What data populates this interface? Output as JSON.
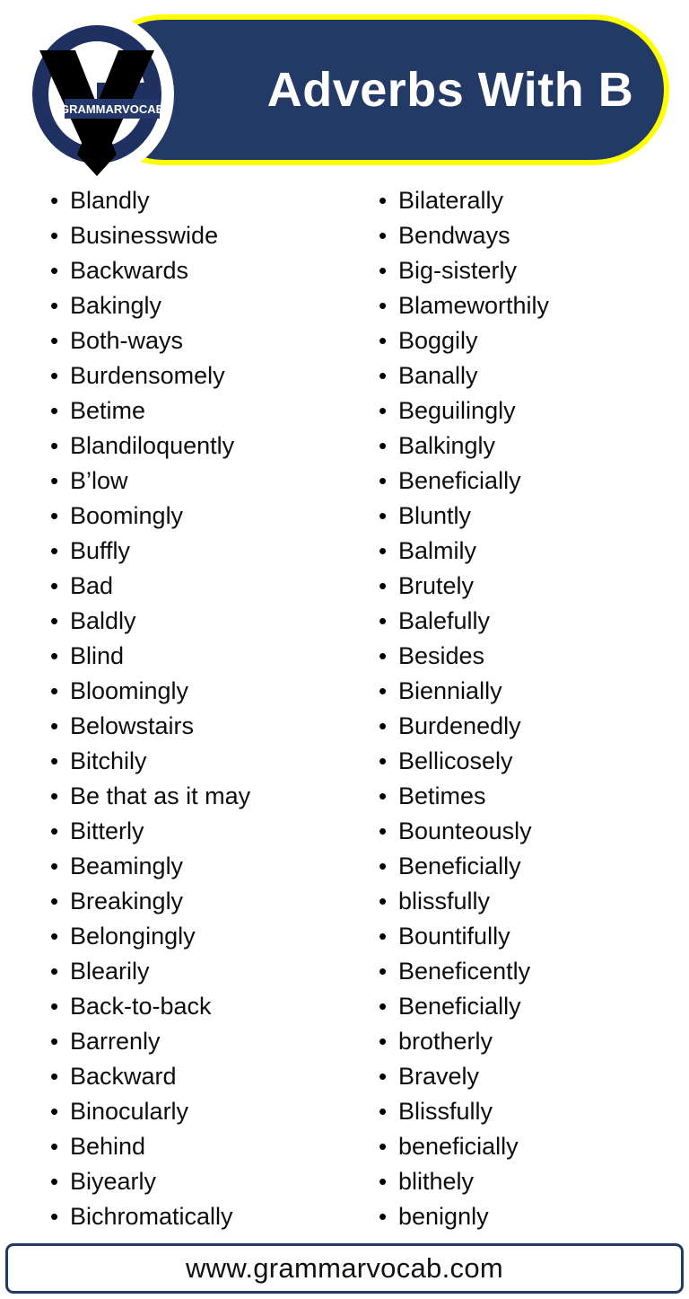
{
  "header": {
    "title": "Adverbs With B",
    "logo": {
      "brand_text": "GRAMMARVOCAB"
    },
    "colors": {
      "banner_fill": "#243a66",
      "banner_border": "#ffff00",
      "title_text": "#ffffff"
    }
  },
  "lists": {
    "bullet_glyph": "•",
    "left_column": [
      "Blandly",
      "Businesswide",
      "Backwards",
      "Bakingly",
      "Both-ways",
      "Burdensomely",
      "Betime",
      "Blandiloquently",
      "B’low",
      "Boomingly",
      "Buffly",
      "Bad",
      "Baldly",
      "Blind",
      "Bloomingly",
      "Belowstairs",
      "Bitchily",
      "Be that as it may",
      "Bitterly",
      "Beamingly",
      "Breakingly",
      "Belongingly",
      "Blearily",
      "Back-to-back",
      "Barrenly",
      "Backward",
      "Binocularly",
      "Behind",
      "Biyearly",
      "Bichromatically"
    ],
    "right_column": [
      "Bilaterally",
      "Bendways",
      "Big-sisterly",
      "Blameworthily",
      "Boggily",
      "Banally",
      "Beguilingly",
      "Balkingly",
      "Beneficially",
      "Bluntly",
      "Balmily",
      "Brutely",
      "Balefully",
      "Besides",
      "Biennially",
      "Burdenedly",
      "Bellicosely",
      "Betimes",
      "Bounteously",
      "Beneficially",
      "blissfully",
      "Bountifully",
      "Beneficently",
      "Beneficially",
      "brotherly",
      "Bravely",
      "Blissfully",
      "beneficially",
      "blithely",
      "benignly"
    ]
  },
  "footer": {
    "website": "www.grammarvocab.com",
    "border_color": "#243a66"
  }
}
